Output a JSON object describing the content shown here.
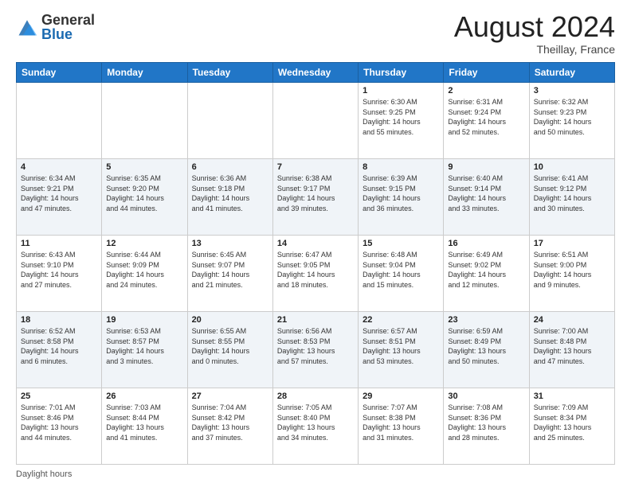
{
  "logo": {
    "general": "General",
    "blue": "Blue"
  },
  "title": {
    "month_year": "August 2024",
    "location": "Theillay, France"
  },
  "footer": {
    "daylight_label": "Daylight hours"
  },
  "days_of_week": [
    "Sunday",
    "Monday",
    "Tuesday",
    "Wednesday",
    "Thursday",
    "Friday",
    "Saturday"
  ],
  "weeks": [
    [
      {
        "num": "",
        "info": ""
      },
      {
        "num": "",
        "info": ""
      },
      {
        "num": "",
        "info": ""
      },
      {
        "num": "",
        "info": ""
      },
      {
        "num": "1",
        "info": "Sunrise: 6:30 AM\nSunset: 9:25 PM\nDaylight: 14 hours\nand 55 minutes."
      },
      {
        "num": "2",
        "info": "Sunrise: 6:31 AM\nSunset: 9:24 PM\nDaylight: 14 hours\nand 52 minutes."
      },
      {
        "num": "3",
        "info": "Sunrise: 6:32 AM\nSunset: 9:23 PM\nDaylight: 14 hours\nand 50 minutes."
      }
    ],
    [
      {
        "num": "4",
        "info": "Sunrise: 6:34 AM\nSunset: 9:21 PM\nDaylight: 14 hours\nand 47 minutes."
      },
      {
        "num": "5",
        "info": "Sunrise: 6:35 AM\nSunset: 9:20 PM\nDaylight: 14 hours\nand 44 minutes."
      },
      {
        "num": "6",
        "info": "Sunrise: 6:36 AM\nSunset: 9:18 PM\nDaylight: 14 hours\nand 41 minutes."
      },
      {
        "num": "7",
        "info": "Sunrise: 6:38 AM\nSunset: 9:17 PM\nDaylight: 14 hours\nand 39 minutes."
      },
      {
        "num": "8",
        "info": "Sunrise: 6:39 AM\nSunset: 9:15 PM\nDaylight: 14 hours\nand 36 minutes."
      },
      {
        "num": "9",
        "info": "Sunrise: 6:40 AM\nSunset: 9:14 PM\nDaylight: 14 hours\nand 33 minutes."
      },
      {
        "num": "10",
        "info": "Sunrise: 6:41 AM\nSunset: 9:12 PM\nDaylight: 14 hours\nand 30 minutes."
      }
    ],
    [
      {
        "num": "11",
        "info": "Sunrise: 6:43 AM\nSunset: 9:10 PM\nDaylight: 14 hours\nand 27 minutes."
      },
      {
        "num": "12",
        "info": "Sunrise: 6:44 AM\nSunset: 9:09 PM\nDaylight: 14 hours\nand 24 minutes."
      },
      {
        "num": "13",
        "info": "Sunrise: 6:45 AM\nSunset: 9:07 PM\nDaylight: 14 hours\nand 21 minutes."
      },
      {
        "num": "14",
        "info": "Sunrise: 6:47 AM\nSunset: 9:05 PM\nDaylight: 14 hours\nand 18 minutes."
      },
      {
        "num": "15",
        "info": "Sunrise: 6:48 AM\nSunset: 9:04 PM\nDaylight: 14 hours\nand 15 minutes."
      },
      {
        "num": "16",
        "info": "Sunrise: 6:49 AM\nSunset: 9:02 PM\nDaylight: 14 hours\nand 12 minutes."
      },
      {
        "num": "17",
        "info": "Sunrise: 6:51 AM\nSunset: 9:00 PM\nDaylight: 14 hours\nand 9 minutes."
      }
    ],
    [
      {
        "num": "18",
        "info": "Sunrise: 6:52 AM\nSunset: 8:58 PM\nDaylight: 14 hours\nand 6 minutes."
      },
      {
        "num": "19",
        "info": "Sunrise: 6:53 AM\nSunset: 8:57 PM\nDaylight: 14 hours\nand 3 minutes."
      },
      {
        "num": "20",
        "info": "Sunrise: 6:55 AM\nSunset: 8:55 PM\nDaylight: 14 hours\nand 0 minutes."
      },
      {
        "num": "21",
        "info": "Sunrise: 6:56 AM\nSunset: 8:53 PM\nDaylight: 13 hours\nand 57 minutes."
      },
      {
        "num": "22",
        "info": "Sunrise: 6:57 AM\nSunset: 8:51 PM\nDaylight: 13 hours\nand 53 minutes."
      },
      {
        "num": "23",
        "info": "Sunrise: 6:59 AM\nSunset: 8:49 PM\nDaylight: 13 hours\nand 50 minutes."
      },
      {
        "num": "24",
        "info": "Sunrise: 7:00 AM\nSunset: 8:48 PM\nDaylight: 13 hours\nand 47 minutes."
      }
    ],
    [
      {
        "num": "25",
        "info": "Sunrise: 7:01 AM\nSunset: 8:46 PM\nDaylight: 13 hours\nand 44 minutes."
      },
      {
        "num": "26",
        "info": "Sunrise: 7:03 AM\nSunset: 8:44 PM\nDaylight: 13 hours\nand 41 minutes."
      },
      {
        "num": "27",
        "info": "Sunrise: 7:04 AM\nSunset: 8:42 PM\nDaylight: 13 hours\nand 37 minutes."
      },
      {
        "num": "28",
        "info": "Sunrise: 7:05 AM\nSunset: 8:40 PM\nDaylight: 13 hours\nand 34 minutes."
      },
      {
        "num": "29",
        "info": "Sunrise: 7:07 AM\nSunset: 8:38 PM\nDaylight: 13 hours\nand 31 minutes."
      },
      {
        "num": "30",
        "info": "Sunrise: 7:08 AM\nSunset: 8:36 PM\nDaylight: 13 hours\nand 28 minutes."
      },
      {
        "num": "31",
        "info": "Sunrise: 7:09 AM\nSunset: 8:34 PM\nDaylight: 13 hours\nand 25 minutes."
      }
    ]
  ]
}
